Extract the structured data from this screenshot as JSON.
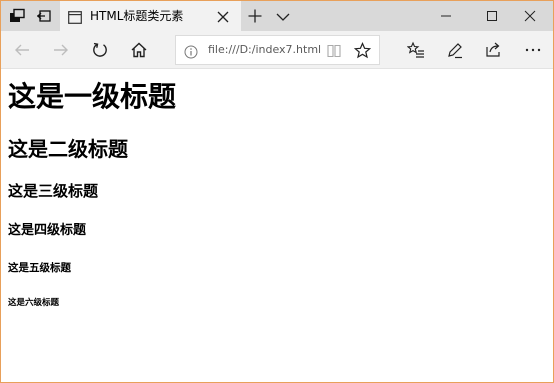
{
  "tab": {
    "title": "HTML标题类元素"
  },
  "address_bar": {
    "url": "file:///D:/index7.html"
  },
  "icons": {
    "tab_manager": "tabs-aside-icon",
    "set_aside": "set-aside-icon",
    "tab_page": "page-icon",
    "tab_close": "close-icon",
    "new_tab": "plus-icon",
    "tab_menu": "chevron-down-icon",
    "minimize": "minimize-icon",
    "maximize": "maximize-icon",
    "close_window": "close-icon",
    "back": "arrow-left-icon",
    "forward": "arrow-right-icon",
    "refresh": "refresh-icon",
    "home": "home-icon",
    "info": "info-icon",
    "reading_view": "book-icon",
    "favorite": "star-icon",
    "favorites_hub": "favorites-list-icon",
    "web_note": "pen-icon",
    "share": "share-icon",
    "more": "more-icon"
  },
  "colors": {
    "tabbar_bg": "#d9d9d9",
    "active_tab_bg": "#f2f2f2",
    "window_border": "#e8a05a"
  },
  "page": {
    "h1": "这是一级标题",
    "h2": "这是二级标题",
    "h3": "这是三级标题",
    "h4": "这是四级标题",
    "h5": "这是五级标题",
    "h6": "这是六级标题"
  }
}
